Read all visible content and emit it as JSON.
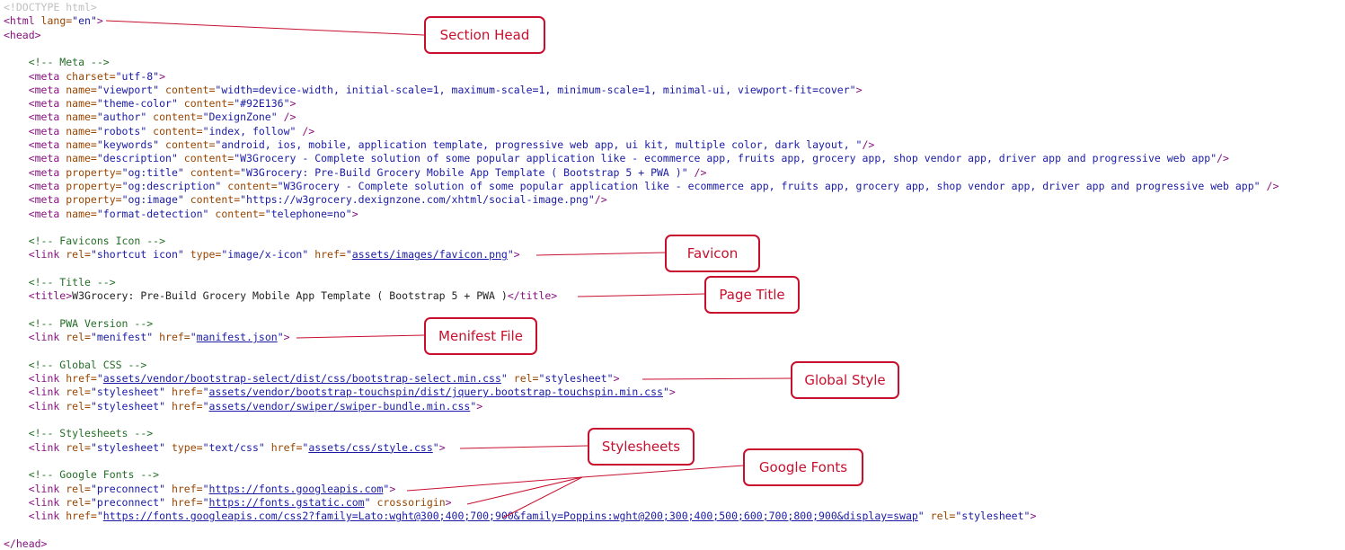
{
  "code_lines": [
    [
      {
        "t": "<!DOCTYPE html>",
        "c": "doct"
      }
    ],
    [
      {
        "t": "<html",
        "c": "tag"
      },
      {
        "t": " lang=",
        "c": "an"
      },
      {
        "t": "\"en\"",
        "c": "av"
      },
      {
        "t": ">",
        "c": "tag"
      }
    ],
    [
      {
        "t": "<head>",
        "c": "tag"
      }
    ],
    [],
    [
      {
        "t": "    <!-- Meta -->",
        "c": "cm"
      }
    ],
    [
      {
        "t": "    <meta",
        "c": "tag"
      },
      {
        "t": " charset=",
        "c": "an"
      },
      {
        "t": "\"utf-8\"",
        "c": "av"
      },
      {
        "t": ">",
        "c": "tag"
      }
    ],
    [
      {
        "t": "    <meta",
        "c": "tag"
      },
      {
        "t": " name=",
        "c": "an"
      },
      {
        "t": "\"viewport\"",
        "c": "av"
      },
      {
        "t": " content=",
        "c": "an"
      },
      {
        "t": "\"width=device-width, initial-scale=1, maximum-scale=1, minimum-scale=1, minimal-ui, viewport-fit=cover\"",
        "c": "av"
      },
      {
        "t": ">",
        "c": "tag"
      }
    ],
    [
      {
        "t": "    <meta",
        "c": "tag"
      },
      {
        "t": " name=",
        "c": "an"
      },
      {
        "t": "\"theme-color\"",
        "c": "av"
      },
      {
        "t": " content=",
        "c": "an"
      },
      {
        "t": "\"#92E136\"",
        "c": "av"
      },
      {
        "t": ">",
        "c": "tag"
      }
    ],
    [
      {
        "t": "    <meta",
        "c": "tag"
      },
      {
        "t": " name=",
        "c": "an"
      },
      {
        "t": "\"author\"",
        "c": "av"
      },
      {
        "t": " content=",
        "c": "an"
      },
      {
        "t": "\"DexignZone\"",
        "c": "av"
      },
      {
        "t": " />",
        "c": "tag"
      }
    ],
    [
      {
        "t": "    <meta",
        "c": "tag"
      },
      {
        "t": " name=",
        "c": "an"
      },
      {
        "t": "\"robots\"",
        "c": "av"
      },
      {
        "t": " content=",
        "c": "an"
      },
      {
        "t": "\"index, follow\"",
        "c": "av"
      },
      {
        "t": " />",
        "c": "tag"
      }
    ],
    [
      {
        "t": "    <meta",
        "c": "tag"
      },
      {
        "t": " name=",
        "c": "an"
      },
      {
        "t": "\"keywords\"",
        "c": "av"
      },
      {
        "t": " content=",
        "c": "an"
      },
      {
        "t": "\"android, ios, mobile, application template, progressive web app, ui kit, multiple color, dark layout, \"",
        "c": "av"
      },
      {
        "t": "/>",
        "c": "tag"
      }
    ],
    [
      {
        "t": "    <meta",
        "c": "tag"
      },
      {
        "t": " name=",
        "c": "an"
      },
      {
        "t": "\"description\"",
        "c": "av"
      },
      {
        "t": " content=",
        "c": "an"
      },
      {
        "t": "\"W3Grocery - Complete solution of some popular application like - ecommerce app, fruits app, grocery app, shop vendor app, driver app and progressive web app\"",
        "c": "av"
      },
      {
        "t": "/>",
        "c": "tag"
      }
    ],
    [
      {
        "t": "    <meta",
        "c": "tag"
      },
      {
        "t": " property=",
        "c": "an"
      },
      {
        "t": "\"og:title\"",
        "c": "av"
      },
      {
        "t": " content=",
        "c": "an"
      },
      {
        "t": "\"W3Grocery: Pre-Build Grocery Mobile App Template ( Bootstrap 5 + PWA )\"",
        "c": "av"
      },
      {
        "t": " />",
        "c": "tag"
      }
    ],
    [
      {
        "t": "    <meta",
        "c": "tag"
      },
      {
        "t": " property=",
        "c": "an"
      },
      {
        "t": "\"og:description\"",
        "c": "av"
      },
      {
        "t": " content=",
        "c": "an"
      },
      {
        "t": "\"W3Grocery - Complete solution of some popular application like - ecommerce app, fruits app, grocery app, shop vendor app, driver app and progressive web app\"",
        "c": "av"
      },
      {
        "t": " />",
        "c": "tag"
      }
    ],
    [
      {
        "t": "    <meta",
        "c": "tag"
      },
      {
        "t": " property=",
        "c": "an"
      },
      {
        "t": "\"og:image\"",
        "c": "av"
      },
      {
        "t": " content=",
        "c": "an"
      },
      {
        "t": "\"https://w3grocery.dexignzone.com/xhtml/social-image.png\"",
        "c": "av"
      },
      {
        "t": "/>",
        "c": "tag"
      }
    ],
    [
      {
        "t": "    <meta",
        "c": "tag"
      },
      {
        "t": " name=",
        "c": "an"
      },
      {
        "t": "\"format-detection\"",
        "c": "av"
      },
      {
        "t": " content=",
        "c": "an"
      },
      {
        "t": "\"telephone=no\"",
        "c": "av"
      },
      {
        "t": ">",
        "c": "tag"
      }
    ],
    [],
    [
      {
        "t": "    <!-- Favicons Icon -->",
        "c": "cm"
      }
    ],
    [
      {
        "t": "    <link",
        "c": "tag"
      },
      {
        "t": " rel=",
        "c": "an"
      },
      {
        "t": "\"shortcut icon\"",
        "c": "av"
      },
      {
        "t": " type=",
        "c": "an"
      },
      {
        "t": "\"image/x-icon\"",
        "c": "av"
      },
      {
        "t": " href=",
        "c": "an"
      },
      {
        "t": "\"",
        "c": "av"
      },
      {
        "t": "assets/images/favicon.png",
        "c": "lnk",
        "link": true
      },
      {
        "t": "\"",
        "c": "av"
      },
      {
        "t": ">",
        "c": "tag"
      }
    ],
    [],
    [
      {
        "t": "    <!-- Title -->",
        "c": "cm"
      }
    ],
    [
      {
        "t": "    <title>",
        "c": "tag"
      },
      {
        "t": "W3Grocery: Pre-Build Grocery Mobile App Template ( Bootstrap 5 + PWA )",
        "c": "txt"
      },
      {
        "t": "</title>",
        "c": "tag"
      }
    ],
    [],
    [
      {
        "t": "    <!-- PWA Version -->",
        "c": "cm"
      }
    ],
    [
      {
        "t": "    <link",
        "c": "tag"
      },
      {
        "t": " rel=",
        "c": "an"
      },
      {
        "t": "\"menifest\"",
        "c": "av"
      },
      {
        "t": " href=",
        "c": "an"
      },
      {
        "t": "\"",
        "c": "av"
      },
      {
        "t": "manifest.json",
        "c": "lnk",
        "link": true
      },
      {
        "t": "\"",
        "c": "av"
      },
      {
        "t": ">",
        "c": "tag"
      }
    ],
    [],
    [
      {
        "t": "    <!-- Global CSS -->",
        "c": "cm"
      }
    ],
    [
      {
        "t": "    <link",
        "c": "tag"
      },
      {
        "t": " href=",
        "c": "an"
      },
      {
        "t": "\"",
        "c": "av"
      },
      {
        "t": "assets/vendor/bootstrap-select/dist/css/bootstrap-select.min.css",
        "c": "lnk",
        "link": true
      },
      {
        "t": "\"",
        "c": "av"
      },
      {
        "t": " rel=",
        "c": "an"
      },
      {
        "t": "\"stylesheet\"",
        "c": "av"
      },
      {
        "t": ">",
        "c": "tag"
      }
    ],
    [
      {
        "t": "    <link",
        "c": "tag"
      },
      {
        "t": " rel=",
        "c": "an"
      },
      {
        "t": "\"stylesheet\"",
        "c": "av"
      },
      {
        "t": " href=",
        "c": "an"
      },
      {
        "t": "\"",
        "c": "av"
      },
      {
        "t": "assets/vendor/bootstrap-touchspin/dist/jquery.bootstrap-touchspin.min.css",
        "c": "lnk",
        "link": true
      },
      {
        "t": "\"",
        "c": "av"
      },
      {
        "t": ">",
        "c": "tag"
      }
    ],
    [
      {
        "t": "    <link",
        "c": "tag"
      },
      {
        "t": " rel=",
        "c": "an"
      },
      {
        "t": "\"stylesheet\"",
        "c": "av"
      },
      {
        "t": " href=",
        "c": "an"
      },
      {
        "t": "\"",
        "c": "av"
      },
      {
        "t": "assets/vendor/swiper/swiper-bundle.min.css",
        "c": "lnk",
        "link": true
      },
      {
        "t": "\"",
        "c": "av"
      },
      {
        "t": ">",
        "c": "tag"
      }
    ],
    [],
    [
      {
        "t": "    <!-- Stylesheets -->",
        "c": "cm"
      }
    ],
    [
      {
        "t": "    <link",
        "c": "tag"
      },
      {
        "t": " rel=",
        "c": "an"
      },
      {
        "t": "\"stylesheet\"",
        "c": "av"
      },
      {
        "t": " type=",
        "c": "an"
      },
      {
        "t": "\"text/css\"",
        "c": "av"
      },
      {
        "t": " href=",
        "c": "an"
      },
      {
        "t": "\"",
        "c": "av"
      },
      {
        "t": "assets/css/style.css",
        "c": "lnk",
        "link": true
      },
      {
        "t": "\"",
        "c": "av"
      },
      {
        "t": ">",
        "c": "tag"
      }
    ],
    [],
    [
      {
        "t": "    <!-- Google Fonts -->",
        "c": "cm"
      }
    ],
    [
      {
        "t": "    <link",
        "c": "tag"
      },
      {
        "t": " rel=",
        "c": "an"
      },
      {
        "t": "\"preconnect\"",
        "c": "av"
      },
      {
        "t": " href=",
        "c": "an"
      },
      {
        "t": "\"",
        "c": "av"
      },
      {
        "t": "https://fonts.googleapis.com",
        "c": "lnk",
        "link": true
      },
      {
        "t": "\"",
        "c": "av"
      },
      {
        "t": ">",
        "c": "tag"
      }
    ],
    [
      {
        "t": "    <link",
        "c": "tag"
      },
      {
        "t": " rel=",
        "c": "an"
      },
      {
        "t": "\"preconnect\"",
        "c": "av"
      },
      {
        "t": " href=",
        "c": "an"
      },
      {
        "t": "\"",
        "c": "av"
      },
      {
        "t": "https://fonts.gstatic.com",
        "c": "lnk",
        "link": true
      },
      {
        "t": "\"",
        "c": "av"
      },
      {
        "t": " crossorigin",
        "c": "an"
      },
      {
        "t": ">",
        "c": "tag"
      }
    ],
    [
      {
        "t": "    <link",
        "c": "tag"
      },
      {
        "t": " href=",
        "c": "an"
      },
      {
        "t": "\"",
        "c": "av"
      },
      {
        "t": "https://fonts.googleapis.com/css2?family=Lato:wght@300;400;700;900&family=Poppins:wght@200;300;400;500;600;700;800;900&display=swap",
        "c": "lnk",
        "link": true
      },
      {
        "t": "\"",
        "c": "av"
      },
      {
        "t": " rel=",
        "c": "an"
      },
      {
        "t": "\"stylesheet\"",
        "c": "av"
      },
      {
        "t": ">",
        "c": "tag"
      }
    ],
    [],
    [
      {
        "t": "</head>",
        "c": "tag"
      }
    ]
  ],
  "callouts": {
    "section_head": "Section Head",
    "favicon": "Favicon",
    "page_title": "Page Title",
    "manifest_file": "Menifest File",
    "global_style": "Global Style",
    "stylesheets": "Stylesheets",
    "google_fonts": "Google Fonts"
  },
  "colors": {
    "callout_red": "#c8102e",
    "tag": "#881280",
    "attr_name": "#994500",
    "attr_value": "#1a1aa6",
    "comment": "#236e25"
  }
}
